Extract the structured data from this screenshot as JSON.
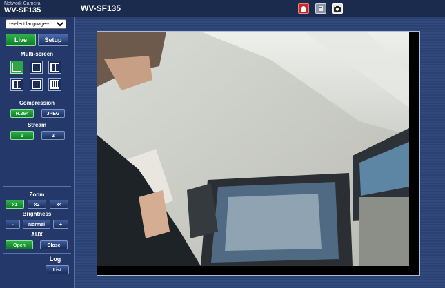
{
  "header": {
    "brand_small": "Network Camera",
    "brand_model": "WV-SF135",
    "camera_title": "WV-SF135",
    "icons": [
      "alarm-icon",
      "sd-icon",
      "snapshot-icon"
    ]
  },
  "language": {
    "selected": "--select language--"
  },
  "nav": {
    "live": "Live",
    "setup": "Setup"
  },
  "multiscreen": {
    "label": "Multi-screen",
    "options": [
      "1",
      "1-4",
      "5-8",
      "9-12",
      "13-16",
      "1-16"
    ]
  },
  "compression": {
    "label": "Compression",
    "options": [
      "H.264",
      "JPEG"
    ],
    "active": "H.264"
  },
  "stream": {
    "label": "Stream",
    "options": [
      "1",
      "2"
    ],
    "active": "1"
  },
  "zoom": {
    "label": "Zoom",
    "options": [
      "x1",
      "x2",
      "x4"
    ],
    "active": "x1"
  },
  "brightness": {
    "label": "Brightness",
    "minus": "-",
    "normal": "Normal",
    "plus": "+"
  },
  "aux": {
    "label": "AUX",
    "open": "Open",
    "close": "Close"
  },
  "log": {
    "label": "Log",
    "list": "List"
  },
  "colors": {
    "accent_green": "#2fa548",
    "sidebar": "#24396a",
    "topbar": "#1a2b4d"
  }
}
